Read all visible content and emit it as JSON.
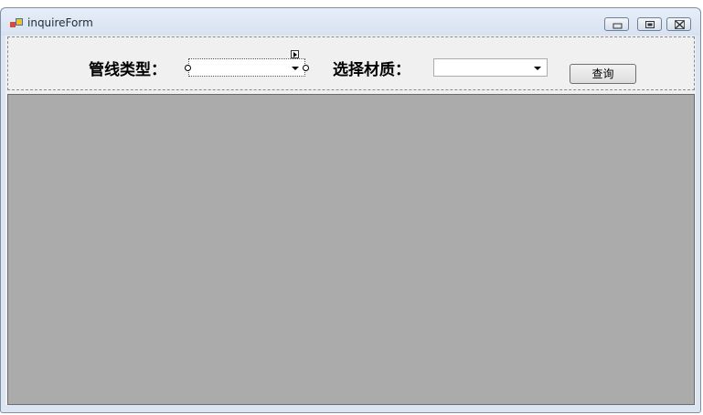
{
  "window": {
    "title": "inquireForm"
  },
  "title_buttons": {
    "minimize": "minimize-icon",
    "maximize": "maximize-icon",
    "close": "close-icon"
  },
  "search_panel": {
    "pipe_type_label": "管线类型：",
    "pipe_type_value": "",
    "material_label": "选择材质：",
    "material_value": "",
    "query_button": "查询"
  },
  "colors": {
    "client_bg": "#f0f0f0",
    "grid_bg": "#ababab",
    "title_bg": "#dce6f2"
  }
}
